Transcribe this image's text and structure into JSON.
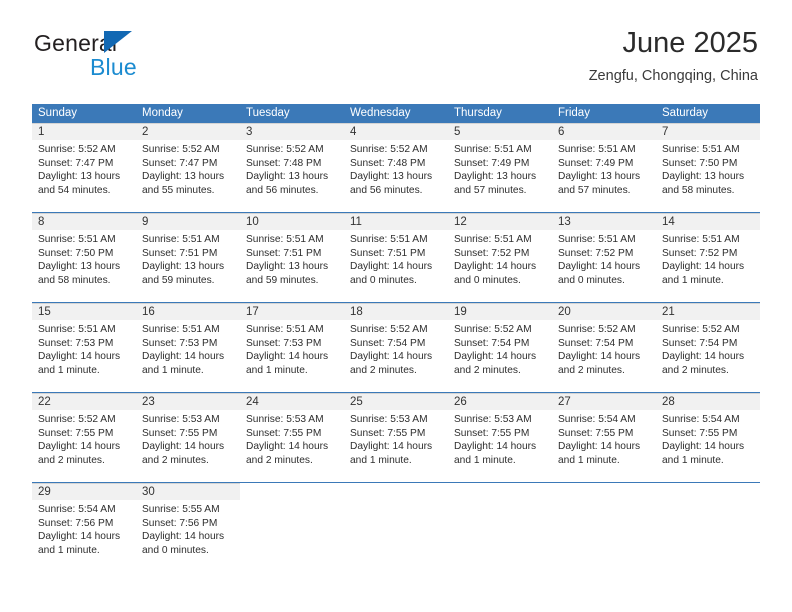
{
  "brand": {
    "name_top": "General",
    "name_bottom": "Blue",
    "accent_dark": "#1268b3",
    "accent_light": "#1b8bd0"
  },
  "header": {
    "title": "June 2025",
    "subtitle": "Zengfu, Chongqing, China"
  },
  "theme": {
    "header_blue": "#3b79b8",
    "daynum_strip": "#f1f1f1",
    "grid_line": "#d4d4d4",
    "text": "#2e2e2e"
  },
  "weekdays": [
    "Sunday",
    "Monday",
    "Tuesday",
    "Wednesday",
    "Thursday",
    "Friday",
    "Saturday"
  ],
  "weeks": [
    {
      "days": [
        {
          "num": "1",
          "sunrise": "Sunrise: 5:52 AM",
          "sunset": "Sunset: 7:47 PM",
          "daylight1": "Daylight: 13 hours",
          "daylight2": "and 54 minutes."
        },
        {
          "num": "2",
          "sunrise": "Sunrise: 5:52 AM",
          "sunset": "Sunset: 7:47 PM",
          "daylight1": "Daylight: 13 hours",
          "daylight2": "and 55 minutes."
        },
        {
          "num": "3",
          "sunrise": "Sunrise: 5:52 AM",
          "sunset": "Sunset: 7:48 PM",
          "daylight1": "Daylight: 13 hours",
          "daylight2": "and 56 minutes."
        },
        {
          "num": "4",
          "sunrise": "Sunrise: 5:52 AM",
          "sunset": "Sunset: 7:48 PM",
          "daylight1": "Daylight: 13 hours",
          "daylight2": "and 56 minutes."
        },
        {
          "num": "5",
          "sunrise": "Sunrise: 5:51 AM",
          "sunset": "Sunset: 7:49 PM",
          "daylight1": "Daylight: 13 hours",
          "daylight2": "and 57 minutes."
        },
        {
          "num": "6",
          "sunrise": "Sunrise: 5:51 AM",
          "sunset": "Sunset: 7:49 PM",
          "daylight1": "Daylight: 13 hours",
          "daylight2": "and 57 minutes."
        },
        {
          "num": "7",
          "sunrise": "Sunrise: 5:51 AM",
          "sunset": "Sunset: 7:50 PM",
          "daylight1": "Daylight: 13 hours",
          "daylight2": "and 58 minutes."
        }
      ]
    },
    {
      "days": [
        {
          "num": "8",
          "sunrise": "Sunrise: 5:51 AM",
          "sunset": "Sunset: 7:50 PM",
          "daylight1": "Daylight: 13 hours",
          "daylight2": "and 58 minutes."
        },
        {
          "num": "9",
          "sunrise": "Sunrise: 5:51 AM",
          "sunset": "Sunset: 7:51 PM",
          "daylight1": "Daylight: 13 hours",
          "daylight2": "and 59 minutes."
        },
        {
          "num": "10",
          "sunrise": "Sunrise: 5:51 AM",
          "sunset": "Sunset: 7:51 PM",
          "daylight1": "Daylight: 13 hours",
          "daylight2": "and 59 minutes."
        },
        {
          "num": "11",
          "sunrise": "Sunrise: 5:51 AM",
          "sunset": "Sunset: 7:51 PM",
          "daylight1": "Daylight: 14 hours",
          "daylight2": "and 0 minutes."
        },
        {
          "num": "12",
          "sunrise": "Sunrise: 5:51 AM",
          "sunset": "Sunset: 7:52 PM",
          "daylight1": "Daylight: 14 hours",
          "daylight2": "and 0 minutes."
        },
        {
          "num": "13",
          "sunrise": "Sunrise: 5:51 AM",
          "sunset": "Sunset: 7:52 PM",
          "daylight1": "Daylight: 14 hours",
          "daylight2": "and 0 minutes."
        },
        {
          "num": "14",
          "sunrise": "Sunrise: 5:51 AM",
          "sunset": "Sunset: 7:52 PM",
          "daylight1": "Daylight: 14 hours",
          "daylight2": "and 1 minute."
        }
      ]
    },
    {
      "days": [
        {
          "num": "15",
          "sunrise": "Sunrise: 5:51 AM",
          "sunset": "Sunset: 7:53 PM",
          "daylight1": "Daylight: 14 hours",
          "daylight2": "and 1 minute."
        },
        {
          "num": "16",
          "sunrise": "Sunrise: 5:51 AM",
          "sunset": "Sunset: 7:53 PM",
          "daylight1": "Daylight: 14 hours",
          "daylight2": "and 1 minute."
        },
        {
          "num": "17",
          "sunrise": "Sunrise: 5:51 AM",
          "sunset": "Sunset: 7:53 PM",
          "daylight1": "Daylight: 14 hours",
          "daylight2": "and 1 minute."
        },
        {
          "num": "18",
          "sunrise": "Sunrise: 5:52 AM",
          "sunset": "Sunset: 7:54 PM",
          "daylight1": "Daylight: 14 hours",
          "daylight2": "and 2 minutes."
        },
        {
          "num": "19",
          "sunrise": "Sunrise: 5:52 AM",
          "sunset": "Sunset: 7:54 PM",
          "daylight1": "Daylight: 14 hours",
          "daylight2": "and 2 minutes."
        },
        {
          "num": "20",
          "sunrise": "Sunrise: 5:52 AM",
          "sunset": "Sunset: 7:54 PM",
          "daylight1": "Daylight: 14 hours",
          "daylight2": "and 2 minutes."
        },
        {
          "num": "21",
          "sunrise": "Sunrise: 5:52 AM",
          "sunset": "Sunset: 7:54 PM",
          "daylight1": "Daylight: 14 hours",
          "daylight2": "and 2 minutes."
        }
      ]
    },
    {
      "days": [
        {
          "num": "22",
          "sunrise": "Sunrise: 5:52 AM",
          "sunset": "Sunset: 7:55 PM",
          "daylight1": "Daylight: 14 hours",
          "daylight2": "and 2 minutes."
        },
        {
          "num": "23",
          "sunrise": "Sunrise: 5:53 AM",
          "sunset": "Sunset: 7:55 PM",
          "daylight1": "Daylight: 14 hours",
          "daylight2": "and 2 minutes."
        },
        {
          "num": "24",
          "sunrise": "Sunrise: 5:53 AM",
          "sunset": "Sunset: 7:55 PM",
          "daylight1": "Daylight: 14 hours",
          "daylight2": "and 2 minutes."
        },
        {
          "num": "25",
          "sunrise": "Sunrise: 5:53 AM",
          "sunset": "Sunset: 7:55 PM",
          "daylight1": "Daylight: 14 hours",
          "daylight2": "and 1 minute."
        },
        {
          "num": "26",
          "sunrise": "Sunrise: 5:53 AM",
          "sunset": "Sunset: 7:55 PM",
          "daylight1": "Daylight: 14 hours",
          "daylight2": "and 1 minute."
        },
        {
          "num": "27",
          "sunrise": "Sunrise: 5:54 AM",
          "sunset": "Sunset: 7:55 PM",
          "daylight1": "Daylight: 14 hours",
          "daylight2": "and 1 minute."
        },
        {
          "num": "28",
          "sunrise": "Sunrise: 5:54 AM",
          "sunset": "Sunset: 7:55 PM",
          "daylight1": "Daylight: 14 hours",
          "daylight2": "and 1 minute."
        }
      ]
    },
    {
      "days": [
        {
          "num": "29",
          "sunrise": "Sunrise: 5:54 AM",
          "sunset": "Sunset: 7:56 PM",
          "daylight1": "Daylight: 14 hours",
          "daylight2": "and 1 minute."
        },
        {
          "num": "30",
          "sunrise": "Sunrise: 5:55 AM",
          "sunset": "Sunset: 7:56 PM",
          "daylight1": "Daylight: 14 hours",
          "daylight2": "and 0 minutes."
        },
        {
          "num": "",
          "sunrise": "",
          "sunset": "",
          "daylight1": "",
          "daylight2": ""
        },
        {
          "num": "",
          "sunrise": "",
          "sunset": "",
          "daylight1": "",
          "daylight2": ""
        },
        {
          "num": "",
          "sunrise": "",
          "sunset": "",
          "daylight1": "",
          "daylight2": ""
        },
        {
          "num": "",
          "sunrise": "",
          "sunset": "",
          "daylight1": "",
          "daylight2": ""
        },
        {
          "num": "",
          "sunrise": "",
          "sunset": "",
          "daylight1": "",
          "daylight2": ""
        }
      ]
    }
  ]
}
